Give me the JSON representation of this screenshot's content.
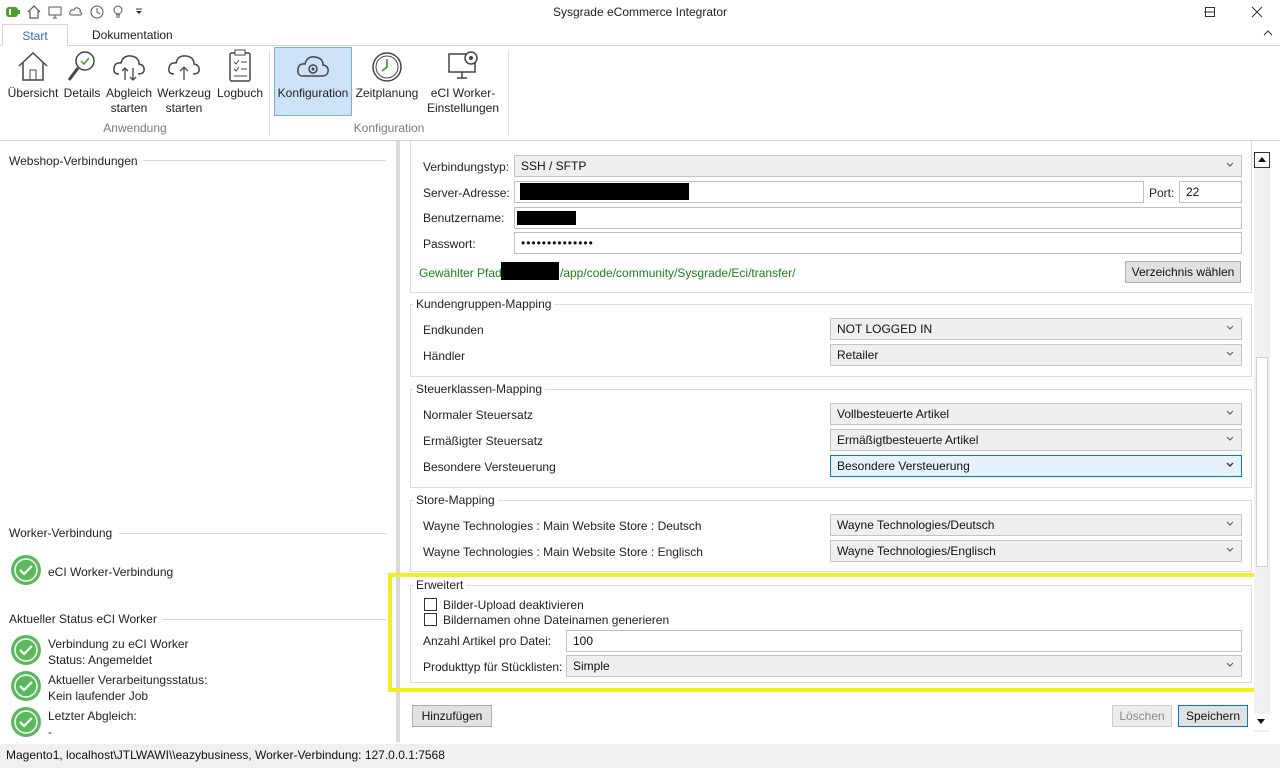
{
  "app": {
    "title": "Sysgrade eCommerce Integrator"
  },
  "ribbon": {
    "tabs": [
      {
        "label": "Start"
      },
      {
        "label": "Dokumentation"
      }
    ],
    "groups": [
      {
        "label": "Anwendung"
      },
      {
        "label": "Konfiguration"
      }
    ],
    "buttons": {
      "uebersicht": "Übersicht",
      "details": "Details",
      "abgleich_1": "Abgleich",
      "abgleich_2": "starten",
      "werkzeug_1": "Werkzeug",
      "werkzeug_2": "starten",
      "logbuch": "Logbuch",
      "konfiguration": "Konfiguration",
      "zeitplanung": "Zeitplanung",
      "worker_1": "eCI Worker-",
      "worker_2": "Einstellungen"
    }
  },
  "left": {
    "webshop_title": "Webshop-Verbindungen",
    "worker_title": "Worker-Verbindung",
    "worker_item": "eCI Worker-Verbindung",
    "status_title": "Aktueller Status eCI Worker",
    "status_items": [
      {
        "line1": "Verbindung zu eCI Worker",
        "line2": "Status: Angemeldet"
      },
      {
        "line1": "Aktueller Verarbeitungsstatus:",
        "line2": "Kein laufender Job"
      },
      {
        "line1": "Letzter Abgleich:",
        "line2": "-"
      }
    ]
  },
  "connection": {
    "type_label": "Verbindungstyp:",
    "type_value": "SSH / SFTP",
    "server_label": "Server-Adresse:",
    "port_label": "Port:",
    "port_value": "22",
    "user_label": "Benutzername:",
    "password_label": "Passwort:",
    "password_value": "••••••••••••••",
    "path_label": "Gewählter Pfad:",
    "path_value": "/app/code/community/Sysgrade/Eci/transfer/",
    "choose_dir": "Verzeichnis wählen"
  },
  "customer_mapping": {
    "title": "Kundengruppen-Mapping",
    "rows": [
      {
        "label": "Endkunden",
        "value": "NOT LOGGED IN"
      },
      {
        "label": "Händler",
        "value": "Retailer"
      }
    ]
  },
  "tax_mapping": {
    "title": "Steuerklassen-Mapping",
    "rows": [
      {
        "label": "Normaler Steuersatz",
        "value": "Vollbesteuerte Artikel"
      },
      {
        "label": "Ermäßigter Steuersatz",
        "value": "Ermäßigtbesteuerte Artikel"
      },
      {
        "label": "Besondere Versteuerung",
        "value": "Besondere Versteuerung"
      }
    ]
  },
  "store_mapping": {
    "title": "Store-Mapping",
    "rows": [
      {
        "label": "Wayne Technologies : Main Website Store : Deutsch",
        "value": "Wayne Technologies/Deutsch"
      },
      {
        "label": "Wayne Technologies : Main Website Store : Englisch",
        "value": "Wayne Technologies/Englisch"
      }
    ]
  },
  "advanced": {
    "title": "Erweitert",
    "cb_upload": "Bilder-Upload deaktivieren",
    "cb_names": "Bildernamen ohne Dateinamen generieren",
    "count_label": "Anzahl Artikel pro Datei:",
    "count_value": "100",
    "type_label": "Produkttyp für Stücklisten:",
    "type_value": "Simple"
  },
  "actions": {
    "add": "Hinzufügen",
    "delete": "Löschen",
    "save": "Speichern"
  },
  "statusbar": {
    "text": "Magento1, localhost\\JTLWAWI\\\\eazybusiness, Worker-Verbindung: 127.0.0.1:7568"
  },
  "colors": {
    "accent": "#2f6db5",
    "path_green": "#1e7d1e",
    "status_green": "#5cb85c",
    "highlight": "#f2ef1a"
  }
}
